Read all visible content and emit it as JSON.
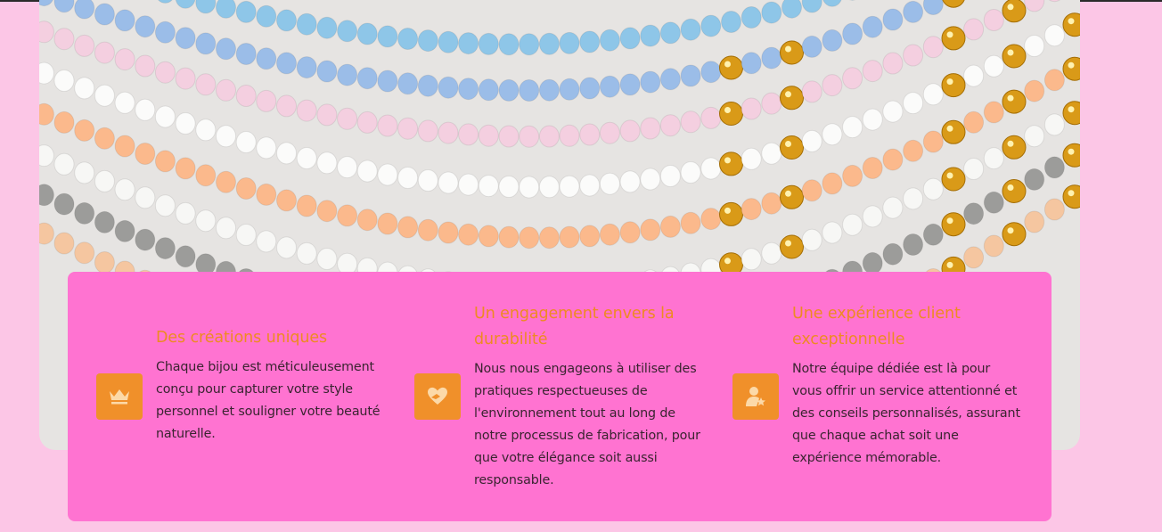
{
  "hero": {
    "image": "bead-necklaces-photo"
  },
  "colors": {
    "page_bg": "#fcc6e6",
    "panel_bg": "#ff73d1",
    "accent": "#f0902a",
    "title": "#ee8a22",
    "text": "#3a2430"
  },
  "features": [
    {
      "icon": "crown-icon",
      "title": "Des créations uniques",
      "description": "Chaque bijou est méticuleusement conçu pour capturer votre style personnel et souligner votre beauté naturelle."
    },
    {
      "icon": "heart-hand-icon",
      "title": "Un engagement envers la durabilité",
      "description": "Nous nous engageons à utiliser des pratiques respectueuses de l'environnement tout au long de notre processus de fabrication, pour que votre élégance soit aussi responsable."
    },
    {
      "icon": "user-star-icon",
      "title": "Une expérience client exceptionnelle",
      "description": "Notre équipe dédiée est là pour vous offrir un service attentionné et des conseils personnalisés, assurant que chaque achat soit une expérience mémorable."
    }
  ]
}
